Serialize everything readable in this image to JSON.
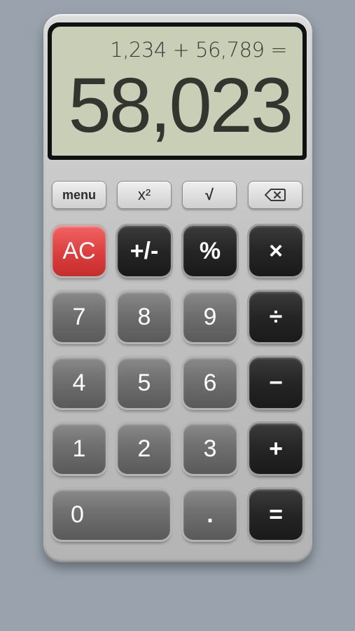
{
  "display": {
    "expression": "1,234 + 56,789 =",
    "result": "58,023"
  },
  "function_row": {
    "menu": "menu",
    "square": "x²",
    "sqrt": "√",
    "backspace_icon": "backspace-icon"
  },
  "keys": {
    "clear": "AC",
    "negate": "+/-",
    "percent": "%",
    "multiply": "×",
    "divide": "÷",
    "subtract": "−",
    "add": "+",
    "equals": "=",
    "decimal": ".",
    "digits": [
      "0",
      "1",
      "2",
      "3",
      "4",
      "5",
      "6",
      "7",
      "8",
      "9"
    ]
  },
  "colors": {
    "background": "#9aa3ad",
    "lcd": "#c9ceb6",
    "clear_key": "#d93b3b",
    "operator_key": "#252525",
    "digit_key": "#6f6f6f"
  }
}
